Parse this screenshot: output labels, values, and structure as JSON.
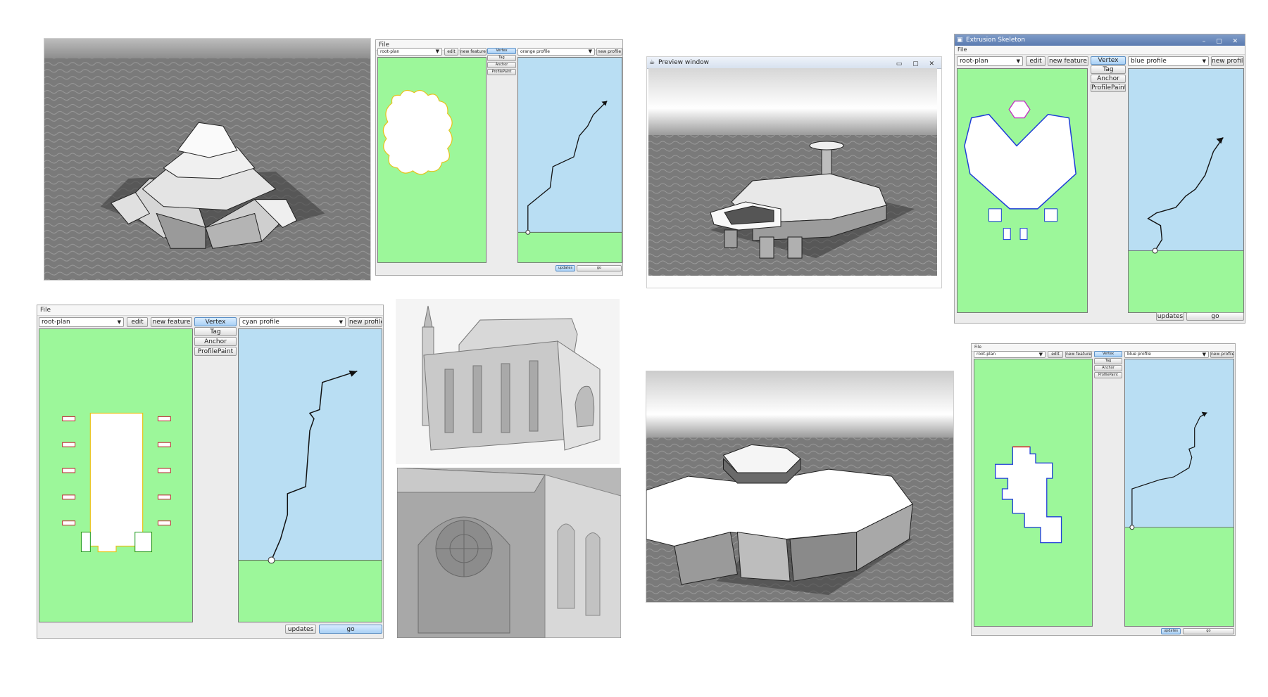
{
  "windows": {
    "w1": {
      "menu": "File",
      "plan_select": "root-plan",
      "edit": "edit",
      "new_feature": "new feature",
      "vertex": "Vertex",
      "tag": "Tag",
      "anchor": "Anchor",
      "profile_paint": "ProfilePaint",
      "profile_select": "orange profile",
      "new_profile": "new profile",
      "updates": "updates",
      "go": "go"
    },
    "w2": {
      "title": "Extrusion Skeleton",
      "menu": "File",
      "plan_select": "root-plan",
      "edit": "edit",
      "new_feature": "new feature",
      "vertex": "Vertex",
      "tag": "Tag",
      "anchor": "Anchor",
      "profile_paint": "ProfilePaint",
      "profile_select": "blue profile",
      "new_profile": "new profile",
      "updates": "updates",
      "go": "go"
    },
    "w3": {
      "menu": "File",
      "plan_select": "root-plan",
      "edit": "edit",
      "new_feature": "new feature",
      "vertex": "Vertex",
      "tag": "Tag",
      "anchor": "Anchor",
      "profile_paint": "ProfilePaint",
      "profile_select": "cyan profile",
      "new_profile": "new profile",
      "updates": "updates",
      "go": "go"
    },
    "w4": {
      "menu": "File",
      "plan_select": "root-plan",
      "edit": "edit",
      "new_feature": "new feature",
      "vertex": "Vertex",
      "tag": "Tag",
      "anchor": "Anchor",
      "profile_paint": "ProfilePaint",
      "profile_select": "blue profile",
      "new_profile": "new profile",
      "updates": "updates",
      "go": "go"
    }
  },
  "preview": {
    "title": "Preview window"
  },
  "colors": {
    "plan_green": "#9cf79a",
    "profile_blue": "#b9def3",
    "edge_yellow": "#e8c21a",
    "edge_blue": "#1e3cd8",
    "edge_red": "#e02020"
  }
}
